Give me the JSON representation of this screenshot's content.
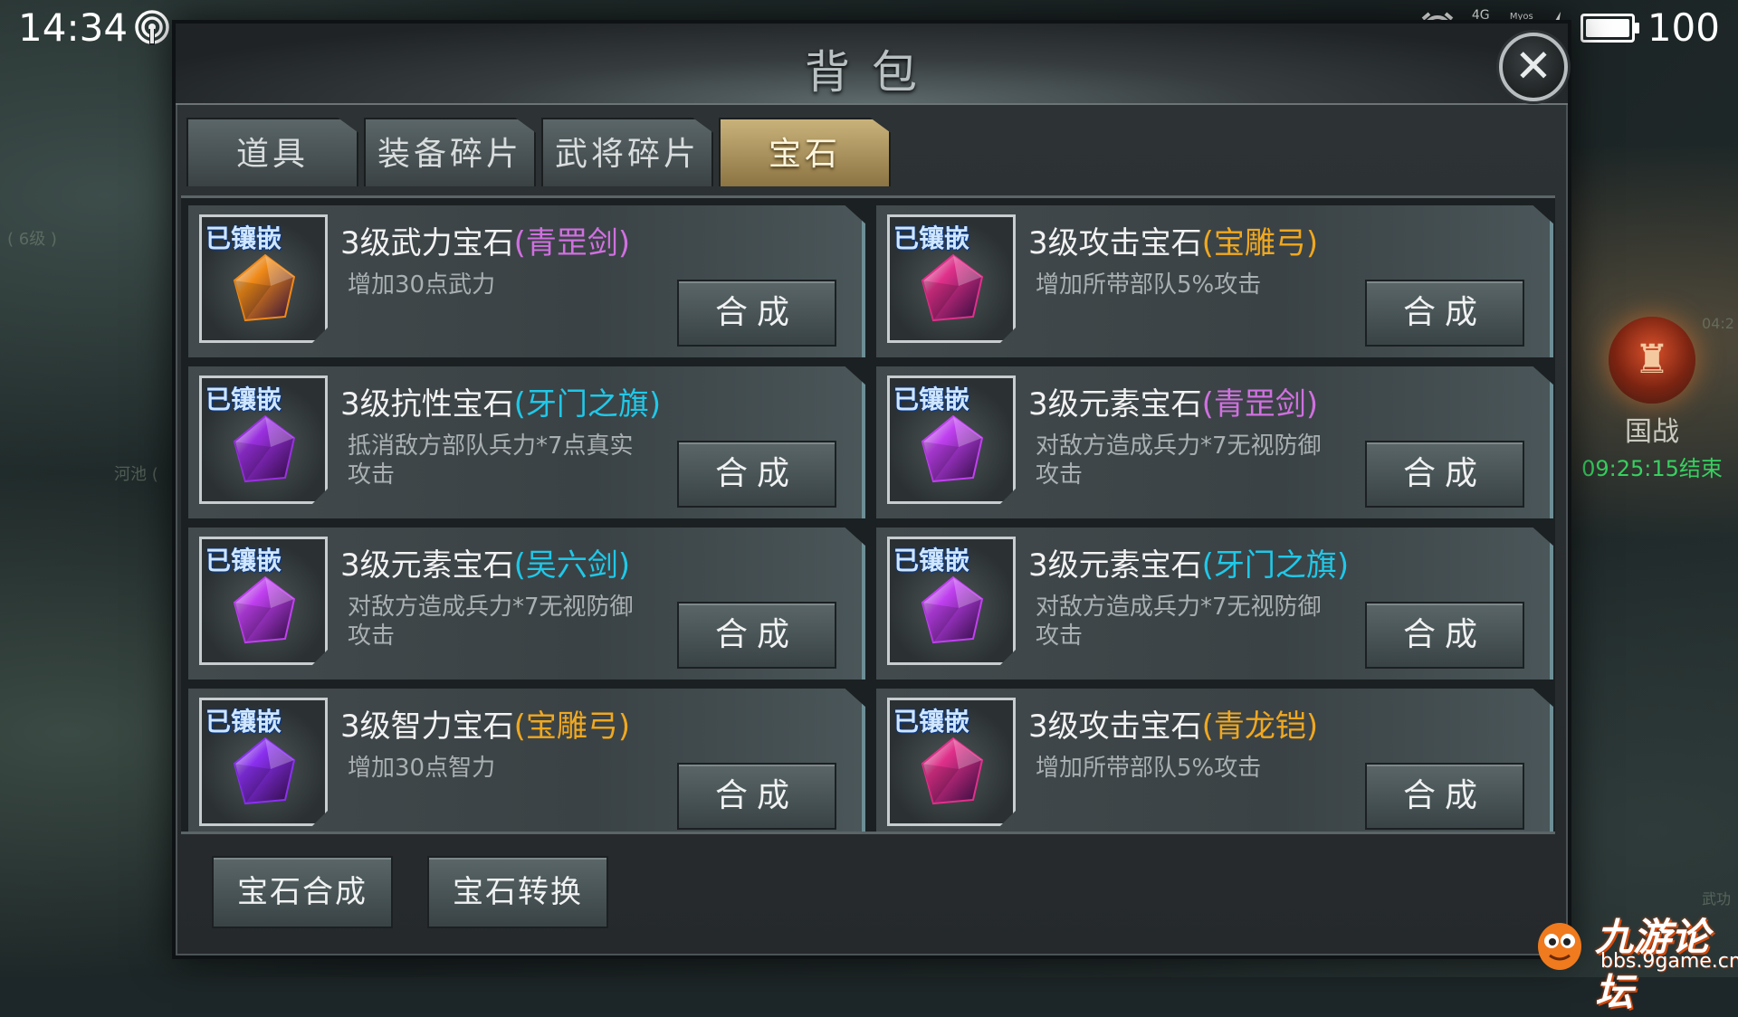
{
  "status_bar": {
    "time": "14:34",
    "network": "4G",
    "carrier": "Myos",
    "battery": "100",
    "battery_level": 1.0,
    "icons": [
      "hotspot-icon",
      "alarm-icon",
      "signal-icon",
      "charging-icon",
      "battery-icon"
    ]
  },
  "window": {
    "title": "背包",
    "close_icon": "close-icon"
  },
  "tabs": [
    {
      "label": "道具",
      "active": false
    },
    {
      "label": "装备碎片",
      "active": false
    },
    {
      "label": "武将碎片",
      "active": false
    },
    {
      "label": "宝石",
      "active": true
    }
  ],
  "gems": [
    {
      "badge": "已镶嵌",
      "name": "3级武力宝石",
      "equip": "(青罡剑)",
      "equip_color": "#d070e0",
      "desc": "增加30点武力",
      "button": "合成",
      "gem_color": "#f08a18"
    },
    {
      "badge": "已镶嵌",
      "name": "3级攻击宝石",
      "equip": "(宝雕弓)",
      "equip_color": "#f0a820",
      "desc": "增加所带部队5%攻击",
      "button": "合成",
      "gem_color": "#e0308a"
    },
    {
      "badge": "已镶嵌",
      "name": "3级抗性宝石",
      "equip": "(牙门之旗)",
      "equip_color": "#20c8e8",
      "desc": "抵消敌方部队兵力*7点真实攻击",
      "button": "合成",
      "gem_color": "#9a30e0"
    },
    {
      "badge": "已镶嵌",
      "name": "3级元素宝石",
      "equip": "(青罡剑)",
      "equip_color": "#d070e0",
      "desc": "对敌方造成兵力*7无视防御攻击",
      "button": "合成",
      "gem_color": "#c040f0"
    },
    {
      "badge": "已镶嵌",
      "name": "3级元素宝石",
      "equip": "(吴六剑)",
      "equip_color": "#20c8e8",
      "desc": "对敌方造成兵力*7无视防御攻击",
      "button": "合成",
      "gem_color": "#c040f0"
    },
    {
      "badge": "已镶嵌",
      "name": "3级元素宝石",
      "equip": "(牙门之旗)",
      "equip_color": "#20c8e8",
      "desc": "对敌方造成兵力*7无视防御攻击",
      "button": "合成",
      "gem_color": "#c040f0"
    },
    {
      "badge": "已镶嵌",
      "name": "3级智力宝石",
      "equip": "(宝雕弓)",
      "equip_color": "#f0a820",
      "desc": "增加30点智力",
      "button": "合成",
      "gem_color": "#8a30f0"
    },
    {
      "badge": "已镶嵌",
      "name": "3级攻击宝石",
      "equip": "(青龙铠)",
      "equip_color": "#f0a820",
      "desc": "增加所带部队5%攻击",
      "button": "合成",
      "gem_color": "#e0308a"
    }
  ],
  "bottom_buttons": {
    "compose": "宝石合成",
    "convert": "宝石转换"
  },
  "map": {
    "level_text": "( 6级 )",
    "river_text": "河池 (",
    "war_label": "国战",
    "war_timer": "09:25:15结束",
    "side_text": "04:2",
    "wu_text": "武功"
  },
  "watermark": {
    "main": "九游论坛",
    "sub": "bbs.9game.cn"
  }
}
